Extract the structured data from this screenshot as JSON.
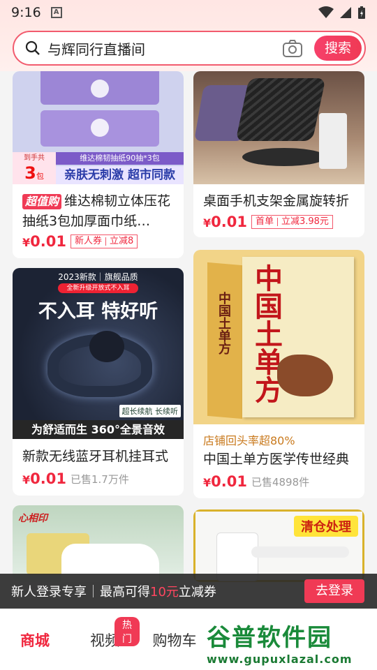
{
  "status_bar": {
    "time": "9:16",
    "notif_letter": "A"
  },
  "search": {
    "query": "与辉同行直播间",
    "button": "搜索"
  },
  "products": [
    {
      "badge": "超值购",
      "title": "维达棉韧立体压花抽纸3包加厚面巾纸…",
      "price_symbol": "¥",
      "price": "0.01",
      "tag1": "新人券",
      "tag2": "立减8",
      "img_texts": {
        "strip": "维达棉韧抽纸90抽*3包",
        "left_top": "到手共",
        "left_num": "3",
        "left_unit": "包",
        "bottom": "亲肤无刺激 超市同款"
      }
    },
    {
      "title": "桌面手机支架金属旋转折",
      "price_symbol": "¥",
      "price": "0.01",
      "tag1": "首单",
      "tag2": "立减3.98元"
    },
    {
      "title": "新款无线蓝牙耳机挂耳式",
      "price_symbol": "¥",
      "price": "0.01",
      "sold": "已售1.7万件",
      "img_texts": {
        "top": "2023新款｜旗舰品质",
        "sub": "全新升级开放式不入耳",
        "headline": "不入耳 特好听",
        "badge": "超长续航 长续听",
        "bottom": "为舒适而生  360°全景音效"
      }
    },
    {
      "pre_title": "店铺回头率超80%",
      "title": "中国土单方医学传世经典",
      "price_symbol": "¥",
      "price": "0.01",
      "sold": "已售4898件",
      "img_texts": {
        "book_title": "中国土单方",
        "spine": "中国土单方"
      }
    },
    {
      "img_texts": {
        "brand": "心相印"
      }
    },
    {
      "img_texts": {
        "clearance": "清仓处理"
      }
    }
  ],
  "login_banner": {
    "part1": "新人登录专享",
    "part2": "最高可得",
    "amount": "10元",
    "part3": "立减券",
    "button": "去登录"
  },
  "tabs": [
    {
      "label": "商城"
    },
    {
      "label": "视频",
      "badge": "热门"
    },
    {
      "label": "购物车"
    }
  ],
  "watermark": {
    "name": "谷普软件园",
    "url": "www.gupuxlazal.com"
  }
}
